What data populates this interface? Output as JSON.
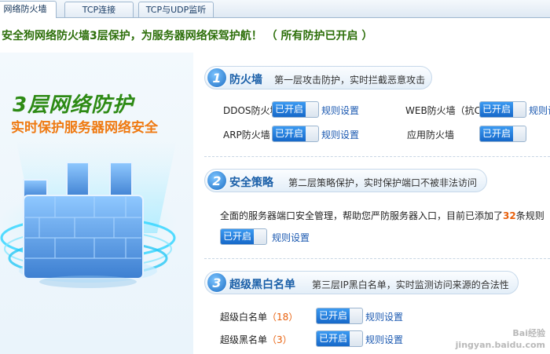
{
  "tabs": [
    {
      "label": "网络防火墙"
    },
    {
      "label": "TCP连接"
    },
    {
      "label": "TCP与UDP监听"
    }
  ],
  "banner": {
    "text": "安全狗网络防火墙3层保护，为服务器网络保驾护航！ （ 所有防护已开启 ）"
  },
  "hero": {
    "title": "3层网络防护",
    "subtitle": "实时保护服务器网络安全"
  },
  "sections": {
    "firewall": {
      "num": "1",
      "title": "防火墙",
      "desc": "第一层攻击防护，实时拦截恶意攻击",
      "items": [
        {
          "label": "DDOS防火墙",
          "state": "已开启",
          "link": "规则设置"
        },
        {
          "label": "WEB防火墙（抗CC）",
          "state": "已开启",
          "link": "规则设置"
        },
        {
          "label": "ARP防火墙",
          "state": "已开启",
          "link": "规则设置"
        },
        {
          "label": "应用防火墙",
          "state": "已开启"
        }
      ]
    },
    "policy": {
      "num": "2",
      "title": "安全策略",
      "desc": "第二层策略保护，实时保护端口不被非法访问",
      "para_prefix": "全面的服务器端口安全管理，帮助您严防服务器入口，目前已添加了",
      "rule_count": "32",
      "para_suffix": "条规则",
      "state": "已开启",
      "link": "规则设置"
    },
    "blacklist": {
      "num": "3",
      "title": "超级黑白名单",
      "desc": "第三层IP黑白名单，实时监测访问来源的合法性",
      "items": [
        {
          "label": "超级白名单",
          "count": "（18）",
          "state": "已开启",
          "link": "规则设置"
        },
        {
          "label": "超级黑名单",
          "count": "（3）",
          "state": "已开启",
          "link": "规则设置"
        }
      ]
    }
  },
  "watermark": {
    "line1": "Bai经验",
    "line2": "jingyan.baidu.com"
  },
  "colors": {
    "accent_blue": "#1668c9",
    "banner_green": "#2d6f0a",
    "hero_orange": "#ef7a12",
    "count_orange": "#e8600c"
  }
}
